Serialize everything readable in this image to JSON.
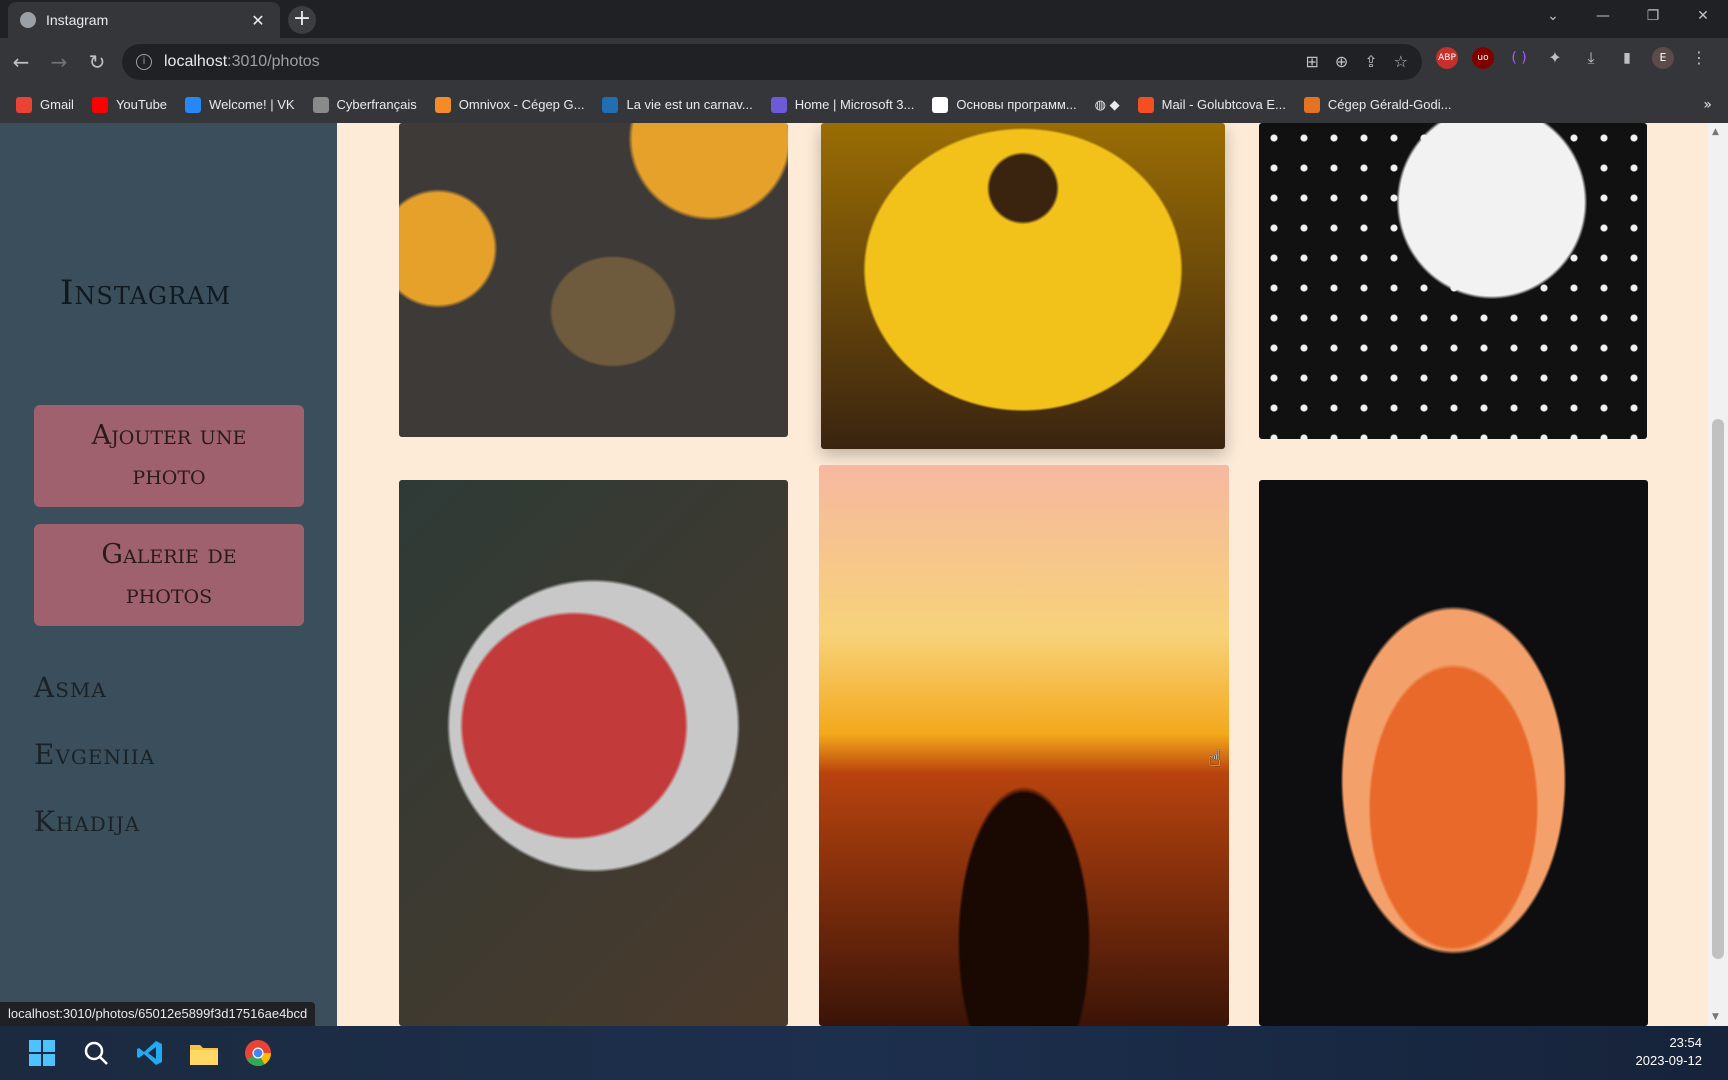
{
  "browser": {
    "tab_title": "Instagram",
    "url_host": "localhost",
    "url_path": ":3010/photos",
    "bookmarks": [
      {
        "label": "Gmail",
        "color": "#ea4335"
      },
      {
        "label": "YouTube",
        "color": "#ff0000"
      },
      {
        "label": "Welcome! | VK",
        "color": "#2787f5"
      },
      {
        "label": "Cyberfrançais",
        "color": "#8a8a8a"
      },
      {
        "label": "Omnivox - Cégep G...",
        "color": "#f28c28"
      },
      {
        "label": "La vie est un carnav...",
        "color": "#1f6fb2"
      },
      {
        "label": "Home | Microsoft 3...",
        "color": "#6b5bd6"
      },
      {
        "label": "Основы программ...",
        "color": "#ffffff"
      },
      {
        "label": "Mail - Golubtcova E...",
        "color": "#f25022"
      },
      {
        "label": "Cégep Gérald-Godi...",
        "color": "#e37222"
      }
    ],
    "status_url": "localhost:3010/photos/65012e5899f3d17516ae4bcd"
  },
  "sidebar": {
    "brand": "Instagram",
    "add_photo": "Ajouter une photo",
    "gallery": "Galerie de photos",
    "users": [
      "Asma",
      "Evgeniia",
      "Khadija"
    ]
  },
  "gallery": {
    "photos": [
      {
        "subject": "pumpkin-and-snail",
        "colors": [
          "#3d3a38",
          "#e6a12a",
          "#6e5a3c"
        ]
      },
      {
        "subject": "yellow-flower",
        "colors": [
          "#f2c21b",
          "#9a6d04",
          "#3a2410"
        ]
      },
      {
        "subject": "hands-polka-dots",
        "colors": [
          "#111111",
          "#f2f2f2",
          "#c8102e"
        ]
      },
      {
        "subject": "apples-in-bucket",
        "colors": [
          "#2e3a36",
          "#c33a3a",
          "#d9d29a"
        ]
      },
      {
        "subject": "dog-sunset",
        "colors": [
          "#f6b8a0",
          "#f4a81c",
          "#3a1408"
        ]
      },
      {
        "subject": "iced-drink",
        "colors": [
          "#0e0e10",
          "#e8692a",
          "#f4a06a"
        ]
      }
    ]
  },
  "taskbar": {
    "time": "23:54",
    "date": "2023-09-12"
  }
}
